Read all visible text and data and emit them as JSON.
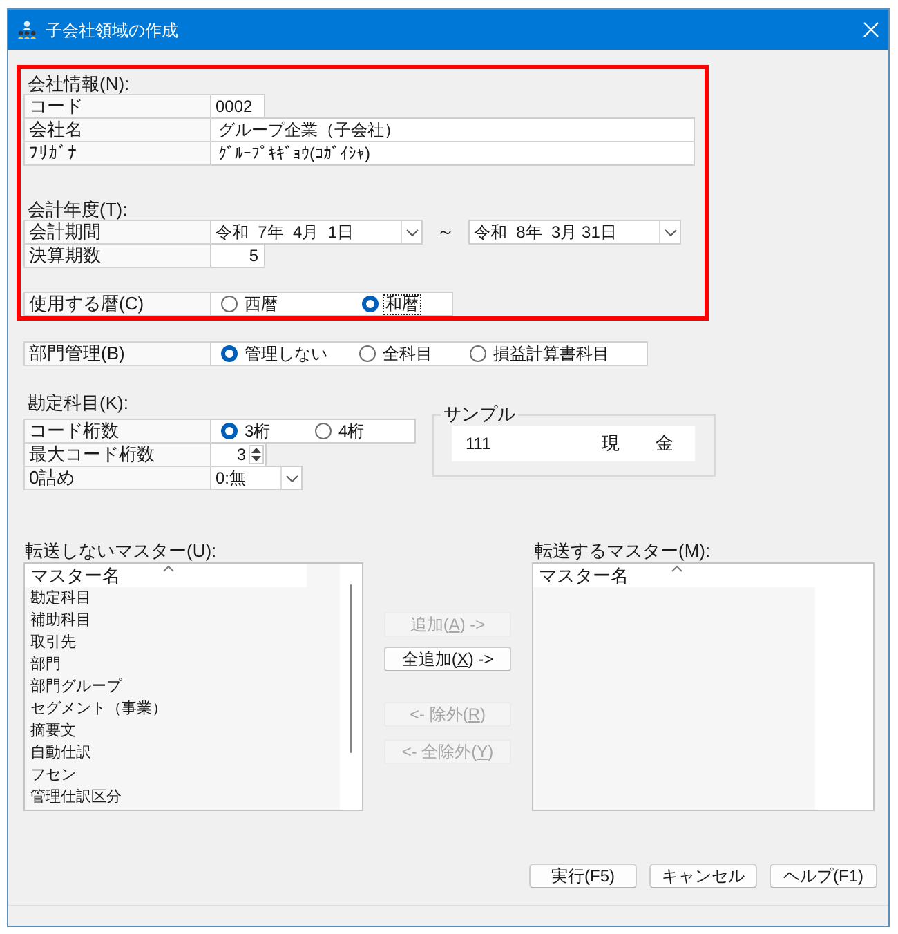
{
  "window": {
    "title": "子会社領域の作成"
  },
  "general": {
    "highlighted": true,
    "company_info": {
      "heading": "会社情報(N):",
      "fields": [
        {
          "label": "コード",
          "value": "0002",
          "kind": "short"
        },
        {
          "label": "会社名",
          "value": "グループ企業（子会社）",
          "kind": "wide"
        },
        {
          "label": "ﾌﾘｶﾞﾅ",
          "value": "ｸﾞﾙｰﾌﾟｷｷﾞｮｳ(ｺｶﾞｲｼｬ)",
          "kind": "wide"
        }
      ]
    },
    "fiscal_year": {
      "heading": "会計年度(T):",
      "period": {
        "label": "会計期間",
        "start": "令和  7年  4月  1日",
        "separator": "～",
        "end": "令和  8年  3月 31日"
      },
      "period_count": {
        "label": "決算期数",
        "value": "5"
      }
    },
    "calendar": {
      "label": "使用する暦(C)",
      "options": [
        {
          "label": "西暦",
          "selected": false,
          "focused": false
        },
        {
          "label": "和暦",
          "selected": true,
          "focused": true
        }
      ]
    }
  },
  "department": {
    "label": "部門管理(B)",
    "options": [
      {
        "label": "管理しない",
        "selected": true
      },
      {
        "label": "全科目",
        "selected": false
      },
      {
        "label": "損益計算書科目",
        "selected": false
      }
    ]
  },
  "accounts": {
    "heading": "勘定科目(K):",
    "code_digits": {
      "label": "コード桁数",
      "options": [
        {
          "label": "3桁",
          "selected": true
        },
        {
          "label": "4桁",
          "selected": false
        }
      ]
    },
    "max_code_digits": {
      "label": "最大コード桁数",
      "value": "3"
    },
    "zero_fill": {
      "label": "0詰め",
      "value": "0:無"
    }
  },
  "sample": {
    "title": "サンプル",
    "code": "111",
    "name": "現　　金"
  },
  "masters_excluded": {
    "heading": "転送しないマスター(U):",
    "column": "マスター名",
    "items": [
      "勘定科目",
      "補助科目",
      "取引先",
      "部門",
      "部門グループ",
      "セグメント（事業）",
      "摘要文",
      "自動仕訳",
      "フセン",
      "管理仕訳区分"
    ]
  },
  "transfer_buttons": [
    {
      "before": "追加(",
      "mnemonic": "A",
      "after": ") ->",
      "disabled": true
    },
    {
      "before": "全追加(",
      "mnemonic": "X",
      "after": ") ->",
      "disabled": false
    },
    {
      "before": "<- 除外(",
      "mnemonic": "R",
      "after": ")",
      "disabled": true
    },
    {
      "before": "<- 全除外(",
      "mnemonic": "Y",
      "after": ")",
      "disabled": true
    }
  ],
  "masters_included": {
    "heading": "転送するマスター(M):",
    "column": "マスター名"
  },
  "footer_buttons": [
    {
      "label": "実行(F5)"
    },
    {
      "label": "キャンセル"
    },
    {
      "label": "ヘルプ(F1)"
    }
  ]
}
